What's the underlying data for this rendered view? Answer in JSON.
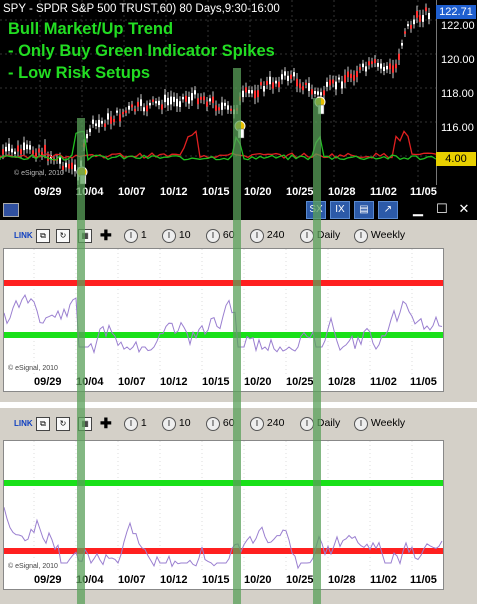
{
  "top_chart": {
    "title": "SPY - SPDR S&P 500 TRUST,60) 80 Days,9:30-16:00",
    "annotations": [
      "Bull Market/Up Trend",
      "- Only Buy Green Indicator Spikes",
      "- Low Risk Setups"
    ],
    "price_labels": [
      "122.00",
      "120.00",
      "118.00",
      "116.00"
    ],
    "last_price": "122.71",
    "osc_price": "4.00",
    "watermark": "© eSignal, 2010",
    "date_labels": [
      "09/29",
      "10/04",
      "10/07",
      "10/12",
      "10/15",
      "10/20",
      "10/25",
      "10/28",
      "11/02",
      "11/05"
    ]
  },
  "window_bar": {
    "btn1": "SX",
    "btn2": "IX",
    "btn3": "▤",
    "btn4": "↗",
    "minimize": "▁",
    "maximize": "☐",
    "close": "✕"
  },
  "toolbar": {
    "link": "LINK",
    "items": [
      "1",
      "10",
      "60",
      "240",
      "Daily",
      "Weekly"
    ]
  },
  "panel1": {
    "watermark": "© eSignal, 2010",
    "date_labels": [
      "09/29",
      "10/04",
      "10/07",
      "10/12",
      "10/15",
      "10/20",
      "10/25",
      "10/28",
      "11/02",
      "11/05"
    ]
  },
  "panel2": {
    "watermark": "© eSignal, 2010",
    "date_labels": [
      "09/29",
      "10/04",
      "10/07",
      "10/12",
      "10/15",
      "10/20",
      "10/25",
      "10/28",
      "11/02",
      "11/05"
    ]
  },
  "colors": {
    "bull_text": "#22dd22",
    "red_band": "#ff2020",
    "green_band": "#19e019",
    "oscillator": "#9a7fd0",
    "highlight": "#5aa05a"
  }
}
